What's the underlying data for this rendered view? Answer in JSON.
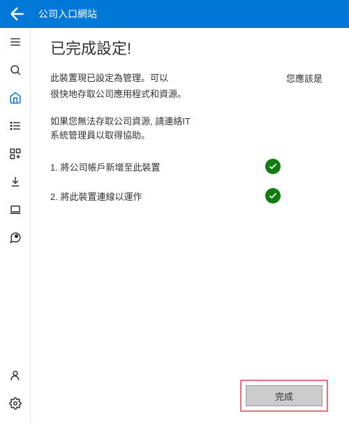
{
  "titlebar": {
    "title": "公司入口網站"
  },
  "heading": "已完成設定!",
  "desc_line1": "此裝置現已設定為管理。可以",
  "desc_right": "您應該是",
  "desc_line2": "很快地存取公司應用程式和資源。",
  "help_line1": "如果您無法存取公司資源, 請連絡IT",
  "help_line2": "系統管理員以取得協助。",
  "steps": [
    {
      "label": "1. 將公司帳戶新增至此裝置"
    },
    {
      "label": "2. 將此裝置連線以運作"
    }
  ],
  "done_label": "完成"
}
